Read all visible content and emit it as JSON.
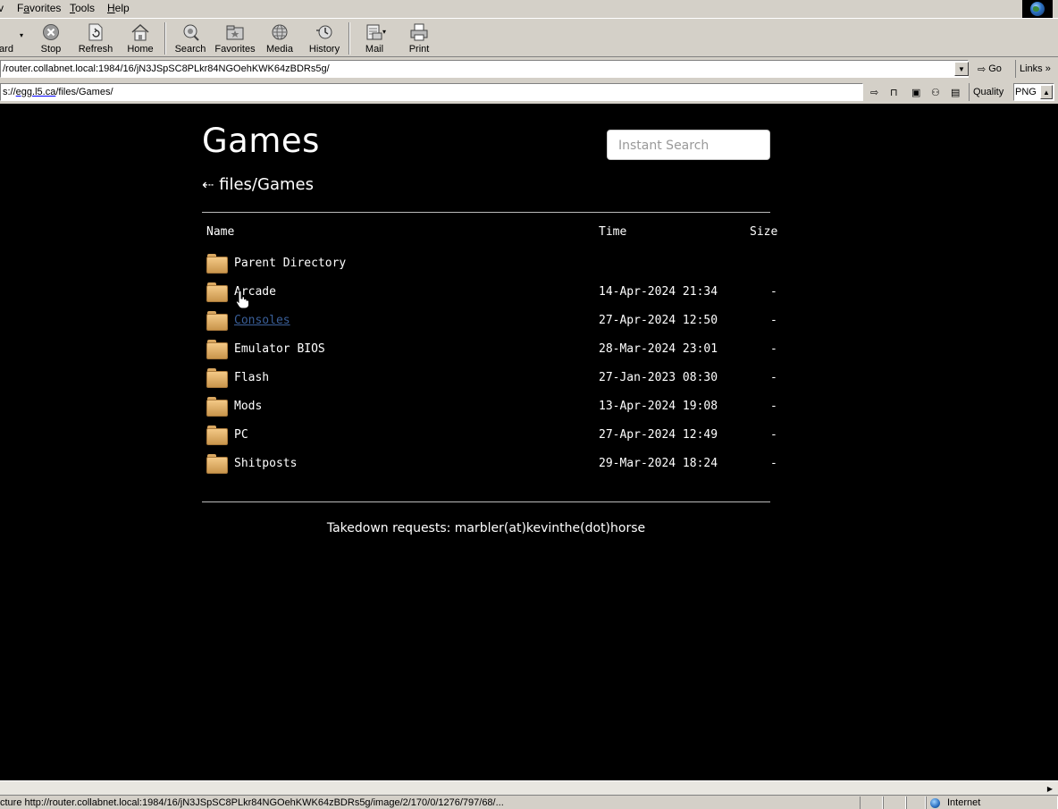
{
  "menu": {
    "items": [
      {
        "label": "v"
      },
      {
        "label": "Favorites",
        "ul": "a"
      },
      {
        "label": "Tools",
        "ul": "T"
      },
      {
        "label": "Help",
        "ul": "H"
      }
    ]
  },
  "toolbar": {
    "forward_label": "ard",
    "stop_label": "Stop",
    "refresh_label": "Refresh",
    "home_label": "Home",
    "search_label": "Search",
    "favorites_label": "Favorites",
    "media_label": "Media",
    "history_label": "History",
    "mail_label": "Mail",
    "print_label": "Print"
  },
  "address": {
    "url": "/router.collabnet.local:1984/16/jN3JSpSC8PLkr84NGOehKWK64zBDRs5g/",
    "go_label": "Go",
    "links_label": "Links"
  },
  "address2": {
    "url_prefix": "s://",
    "url_host": "egg.l5.ca",
    "url_path": "/files/Games/",
    "quality_label": "Quality",
    "format_value": "PNG"
  },
  "page": {
    "title": "Games",
    "search_placeholder": "Instant Search",
    "breadcrumb": "files/Games",
    "back_arrow": "⇠",
    "columns": {
      "name": "Name",
      "time": "Time",
      "size": "Size"
    },
    "rows": [
      {
        "name": "Parent Directory",
        "time": "",
        "size": ""
      },
      {
        "name": "Arcade",
        "time": "14-Apr-2024 21:34",
        "size": "-"
      },
      {
        "name": "Consoles",
        "time": "27-Apr-2024 12:50",
        "size": "-"
      },
      {
        "name": "Emulator BIOS",
        "time": "28-Mar-2024 23:01",
        "size": "-"
      },
      {
        "name": "Flash",
        "time": "27-Jan-2023 08:30",
        "size": "-"
      },
      {
        "name": "Mods",
        "time": "13-Apr-2024 19:08",
        "size": "-"
      },
      {
        "name": "PC",
        "time": "27-Apr-2024 12:49",
        "size": "-"
      },
      {
        "name": "Shitposts",
        "time": "29-Mar-2024 18:24",
        "size": "-"
      }
    ],
    "footer": "Takedown requests: marbler(at)kevinthe(dot)horse"
  },
  "status": {
    "text": "cture http://router.collabnet.local:1984/16/jN3JSpSC8PLkr84NGOehKWK64zBDRs5g/image/2/170/0/1276/797/68/...",
    "zone": "Internet"
  }
}
